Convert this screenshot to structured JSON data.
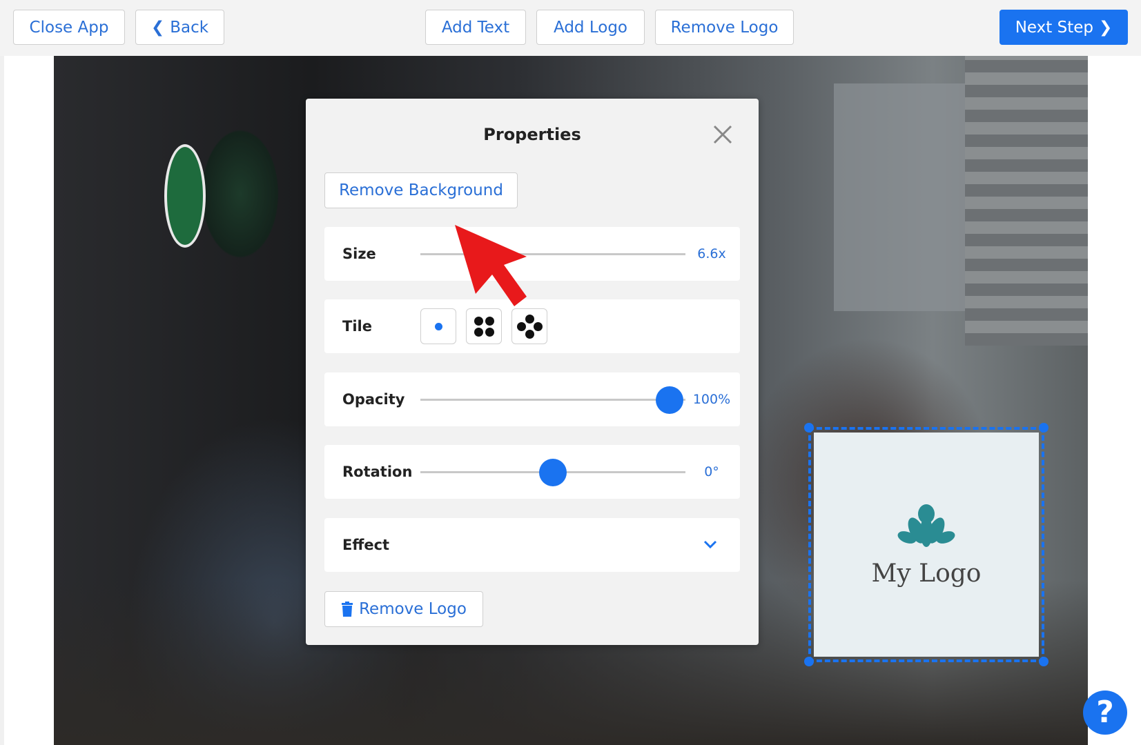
{
  "toolbar": {
    "close_app": "Close App",
    "back": "Back",
    "add_text": "Add Text",
    "add_logo": "Add Logo",
    "remove_logo": "Remove Logo",
    "next_step": "Next Step"
  },
  "panel": {
    "title": "Properties",
    "remove_background": "Remove Background",
    "size": {
      "label": "Size",
      "value": "6.6x"
    },
    "tile": {
      "label": "Tile",
      "options": [
        "single",
        "grid-4",
        "diamond-4"
      ],
      "selected": "single"
    },
    "opacity": {
      "label": "Opacity",
      "value": "100%",
      "level": 1.0
    },
    "rotation": {
      "label": "Rotation",
      "value": "0°",
      "level": 0.5
    },
    "effect": {
      "label": "Effect"
    },
    "remove_logo": "Remove Logo"
  },
  "logo": {
    "text": "My Logo"
  },
  "help": "?",
  "colors": {
    "accent": "#1a73f0",
    "arrow": "#e8191b"
  }
}
